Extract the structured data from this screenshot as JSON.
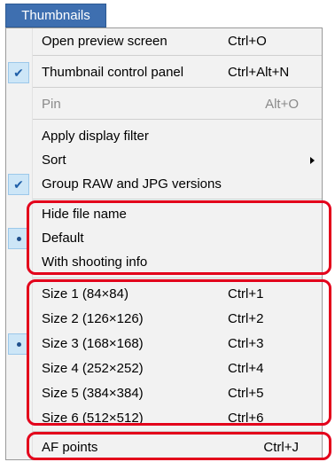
{
  "menu_title": "Thumbnails",
  "items": {
    "open_preview": {
      "label": "Open preview screen",
      "shortcut": "Ctrl+O"
    },
    "thumb_panel": {
      "label": "Thumbnail control panel",
      "shortcut": "Ctrl+Alt+N",
      "checked": true
    },
    "pin": {
      "label": "Pin",
      "shortcut": "Alt+O",
      "disabled": true
    },
    "apply_filter": {
      "label": "Apply display filter"
    },
    "sort": {
      "label": "Sort"
    },
    "group_raw": {
      "label": "Group RAW and JPG versions",
      "checked": true
    },
    "hide_name": {
      "label": "Hide file name"
    },
    "default": {
      "label": "Default",
      "selected": true
    },
    "shooting_info": {
      "label": "With shooting info"
    },
    "size1": {
      "label": "Size 1 (84×84)",
      "shortcut": "Ctrl+1"
    },
    "size2": {
      "label": "Size 2 (126×126)",
      "shortcut": "Ctrl+2"
    },
    "size3": {
      "label": "Size 3 (168×168)",
      "shortcut": "Ctrl+3",
      "selected": true
    },
    "size4": {
      "label": "Size 4 (252×252)",
      "shortcut": "Ctrl+4"
    },
    "size5": {
      "label": "Size 5 (384×384)",
      "shortcut": "Ctrl+5"
    },
    "size6": {
      "label": "Size 6 (512×512)",
      "shortcut": "Ctrl+6"
    },
    "af_points": {
      "label": "AF points",
      "shortcut": "Ctrl+J"
    }
  },
  "colors": {
    "menu_title_bg": "#3e6fb0",
    "highlight": "#e3001b",
    "check_bg": "#cde6f7"
  }
}
